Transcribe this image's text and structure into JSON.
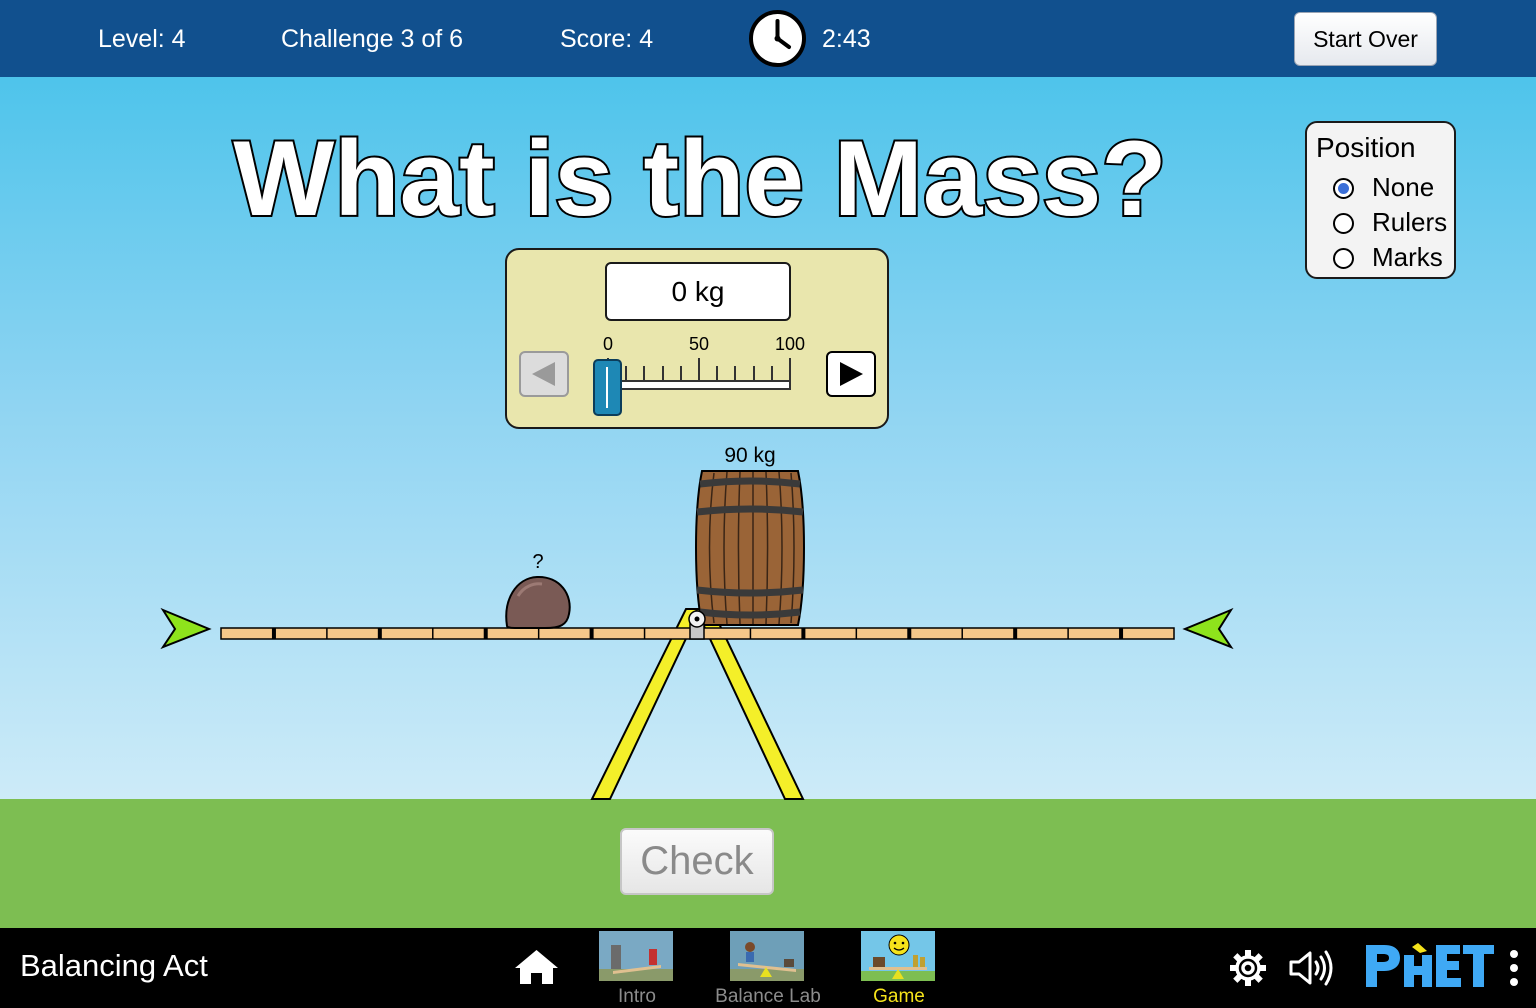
{
  "topbar": {
    "level": "Level: 4",
    "challenge": "Challenge 3 of 6",
    "score": "Score: 4",
    "timer": "2:43",
    "start_over_label": "Start Over"
  },
  "challenge": {
    "title": "What is the Mass?"
  },
  "position_panel": {
    "label": "Position",
    "options": [
      {
        "label": "None",
        "selected": true
      },
      {
        "label": "Rulers",
        "selected": false
      },
      {
        "label": "Marks",
        "selected": false
      }
    ]
  },
  "mass_entry": {
    "readout": "0 kg",
    "slider": {
      "min_label": "0",
      "mid_label": "50",
      "max_label": "100",
      "value": 0,
      "min": 0,
      "max": 100
    }
  },
  "scene": {
    "barrel_label": "90 kg",
    "rock_label": "?"
  },
  "check_label": "Check",
  "navbar": {
    "app_title": "Balancing Act",
    "screens": [
      {
        "label": "Intro",
        "active": false
      },
      {
        "label": "Balance Lab",
        "active": false
      },
      {
        "label": "Game",
        "active": true
      }
    ]
  },
  "colors": {
    "topbar": "#11508e",
    "sky_top": "#4ec4eb",
    "ground": "#7dbe52",
    "plank": "#f5c88a",
    "fulcrum": "#f4ef29",
    "panel": "#e9e6ad",
    "slider_thumb": "#1e88b5",
    "level_marker": "#8ee31c",
    "active_tab": "#f5e31b"
  },
  "icons": [
    "clock-icon",
    "home-icon",
    "gear-icon",
    "speaker-icon",
    "phet-logo",
    "kebab-menu-icon"
  ]
}
